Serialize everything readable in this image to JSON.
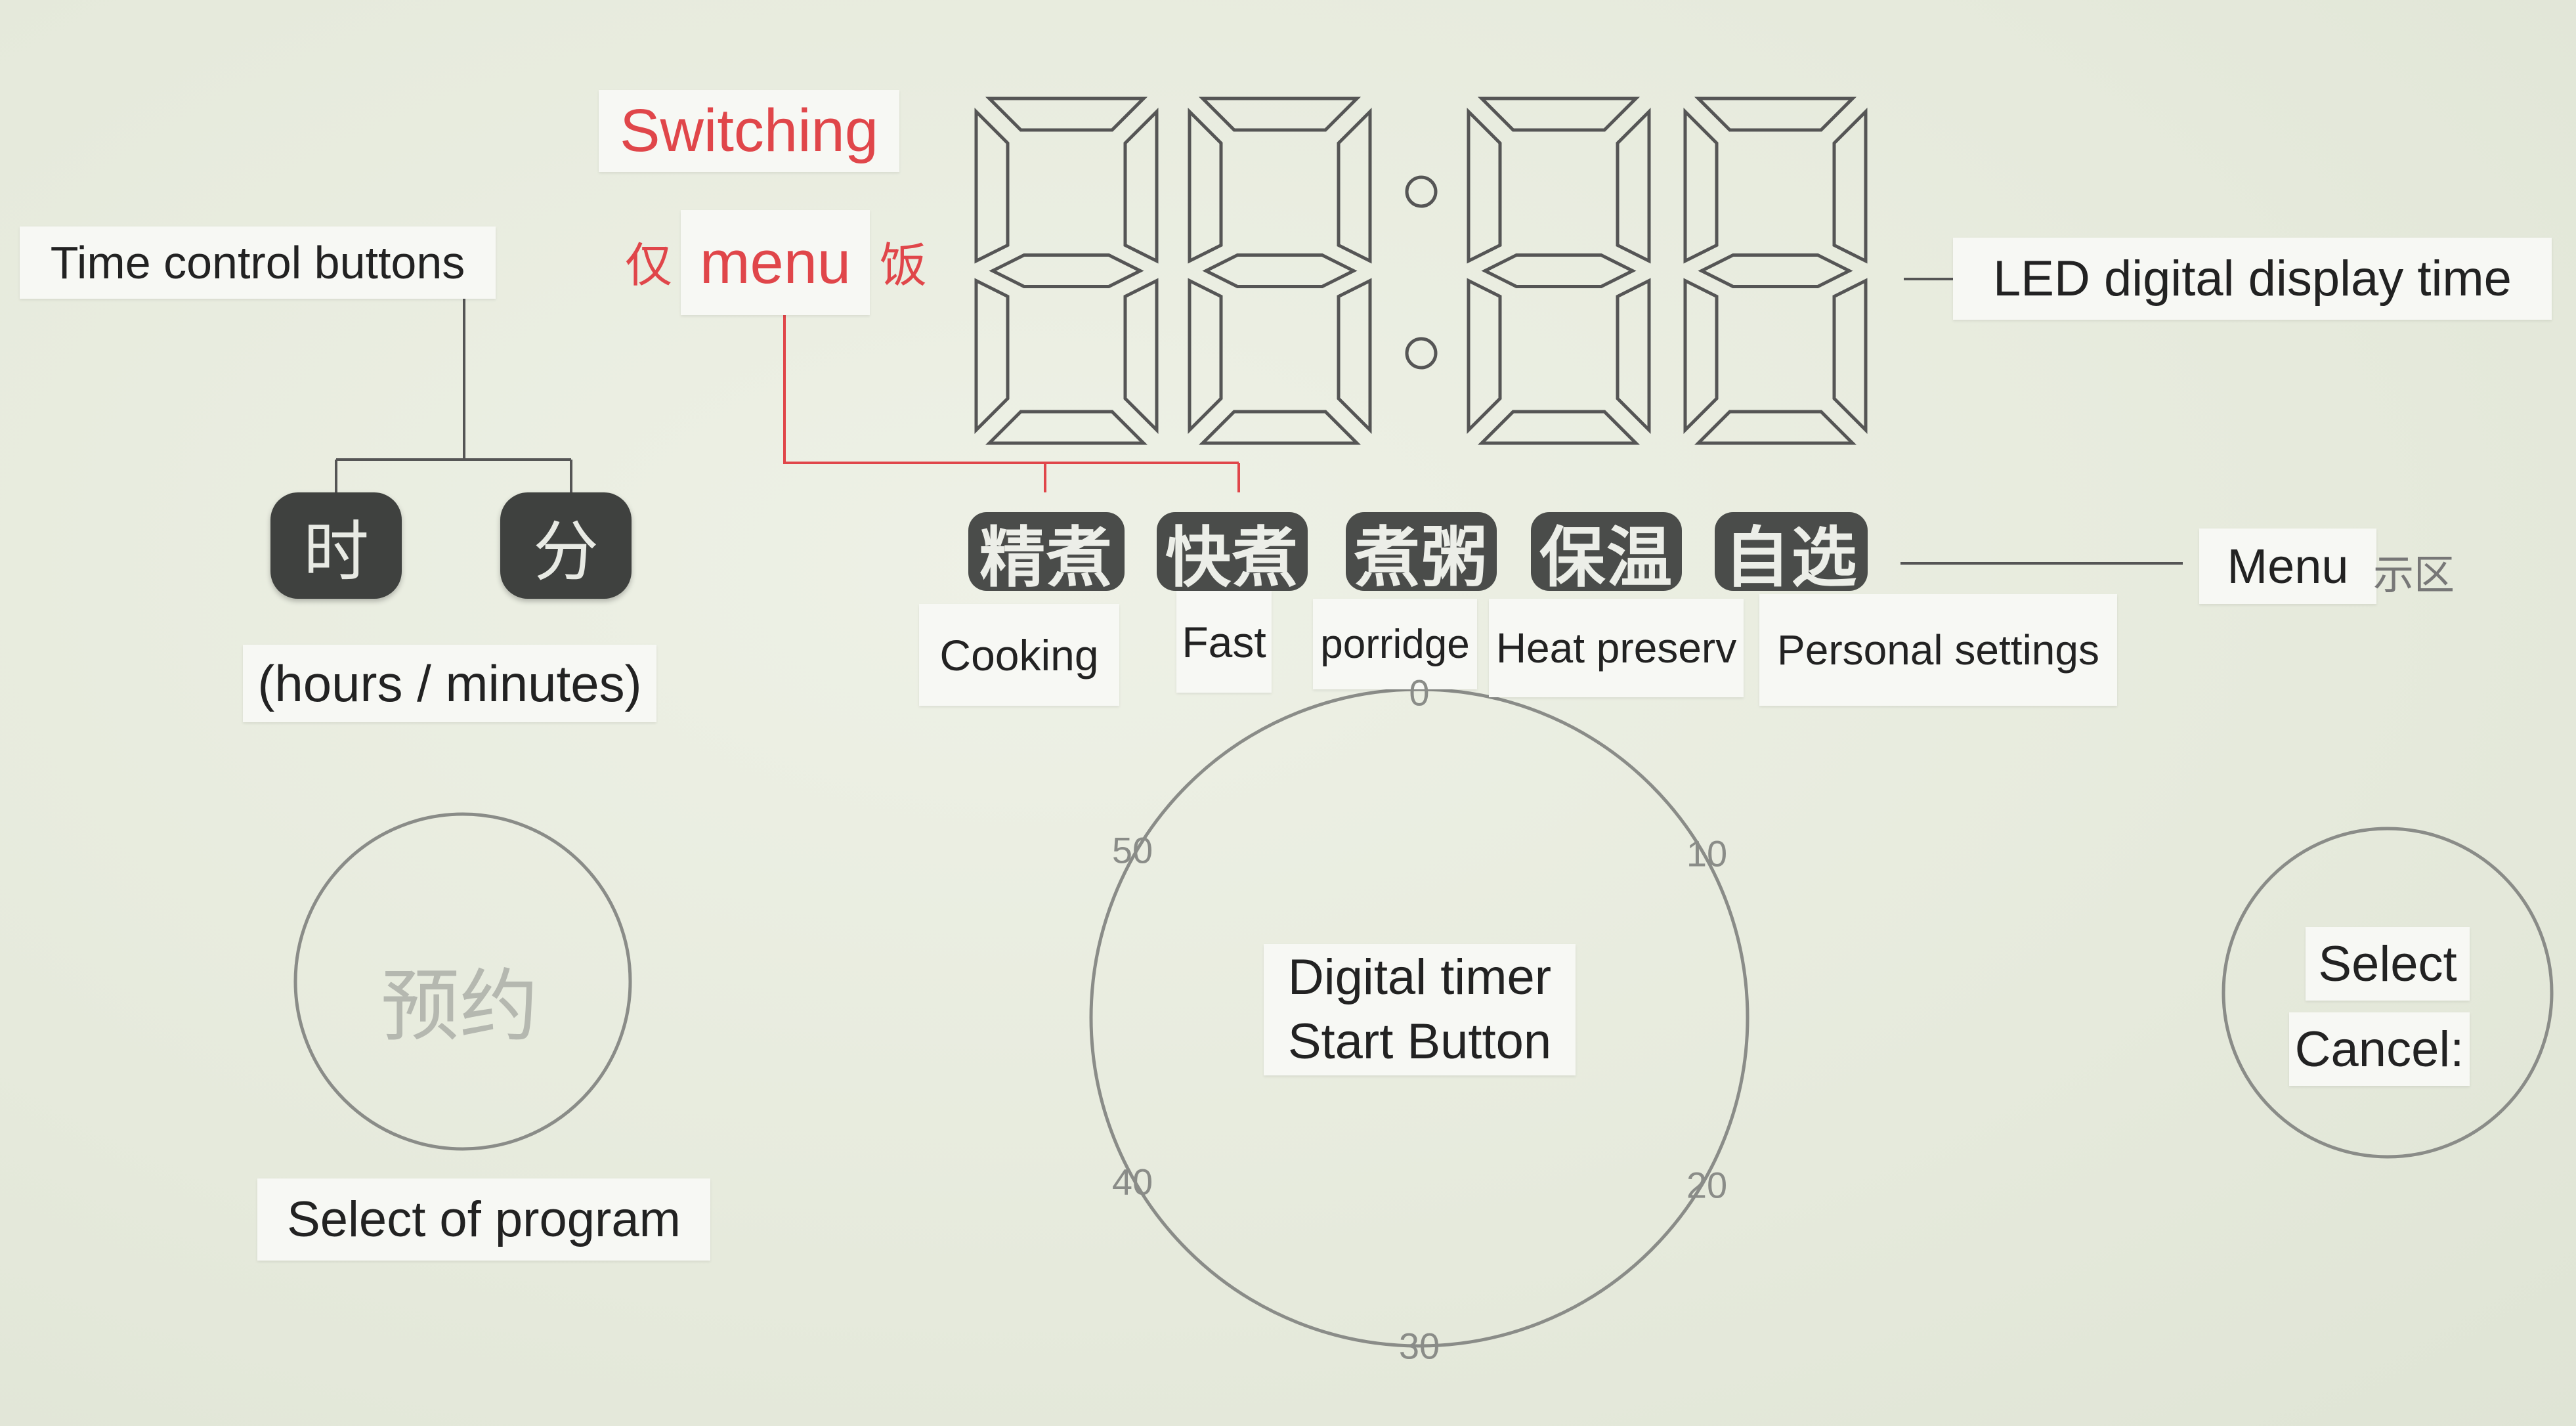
{
  "labels": {
    "time_control": "Time control buttons",
    "hours_minutes": "(hours / minutes)",
    "switching": "Switching",
    "menu_small": "menu",
    "cn_left": "仅",
    "cn_right": "饭",
    "led_display": "LED digital display time",
    "menu": "Menu",
    "menu_cn_suffix": "示区",
    "select_program": "Select of program",
    "timer_line1": "Digital timer",
    "timer_line2": "Start Button",
    "select": "Select",
    "cancel": "Cancel:"
  },
  "time_buttons": [
    {
      "label": "时"
    },
    {
      "label": "分"
    }
  ],
  "menu_items": [
    {
      "cn": "精煮",
      "en": "Cooking"
    },
    {
      "cn": "快煮",
      "en": "Fast"
    },
    {
      "cn": "煮粥",
      "en": "porridge"
    },
    {
      "cn": "保温",
      "en": "Heat preserv"
    },
    {
      "cn": "自选",
      "en": "Personal settings"
    }
  ],
  "reserve_button": {
    "label": "预约"
  },
  "dial_ticks": [
    "0",
    "10",
    "20",
    "30",
    "40",
    "50"
  ],
  "colors": {
    "accent_red": "#e0464a",
    "chip": "#4a4c4a",
    "background": "#e8ecdf"
  }
}
